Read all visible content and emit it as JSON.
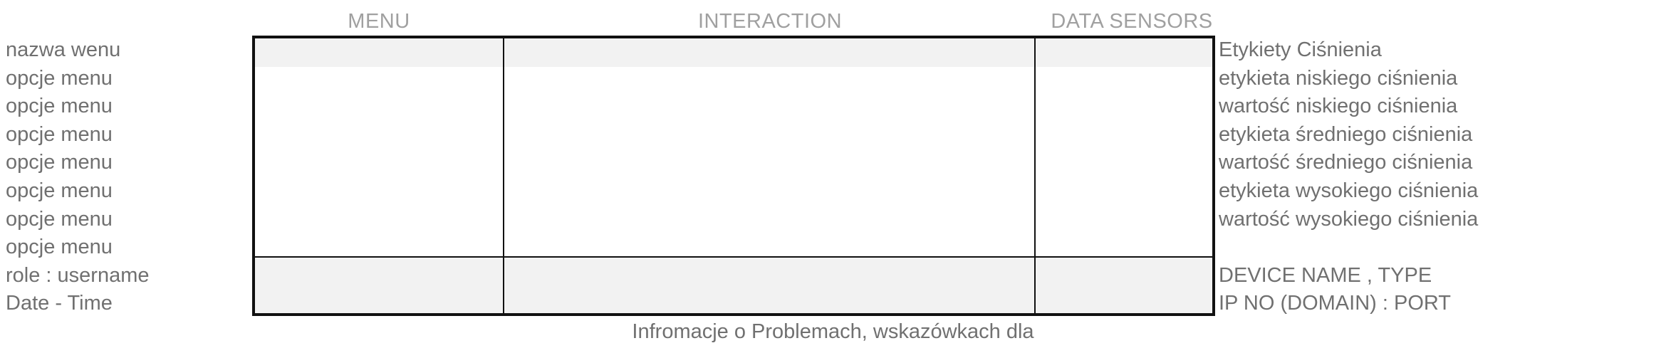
{
  "headers": {
    "menu": "MENU",
    "interaction": "INTERACTION",
    "data_sensors": "DATA SENSORS"
  },
  "left_column": {
    "menu_name": "nazwa wenu",
    "menu_options": [
      "opcje menu",
      "opcje menu",
      "opcje menu",
      "opcje menu",
      "opcje menu",
      "opcje menu",
      "opcje menu"
    ],
    "role_user": "role : username",
    "date_time": "Date - Time"
  },
  "right_column": {
    "pressure_title": "Etykiety Ciśnienia",
    "pressure_items": [
      "etykieta niskiego ciśnienia",
      "wartość niskiego ciśnienia",
      "etykieta średniego ciśnienia",
      "wartość średniego ciśnienia",
      "etykieta wysokiego ciśnienia",
      "wartość wysokiego ciśnienia"
    ],
    "device_name_type": "DEVICE NAME , TYPE",
    "ip_port": "IP NO (DOMAIN) : PORT"
  },
  "footer_caption": "Infromacje o Problemach, wskazówkach dla"
}
